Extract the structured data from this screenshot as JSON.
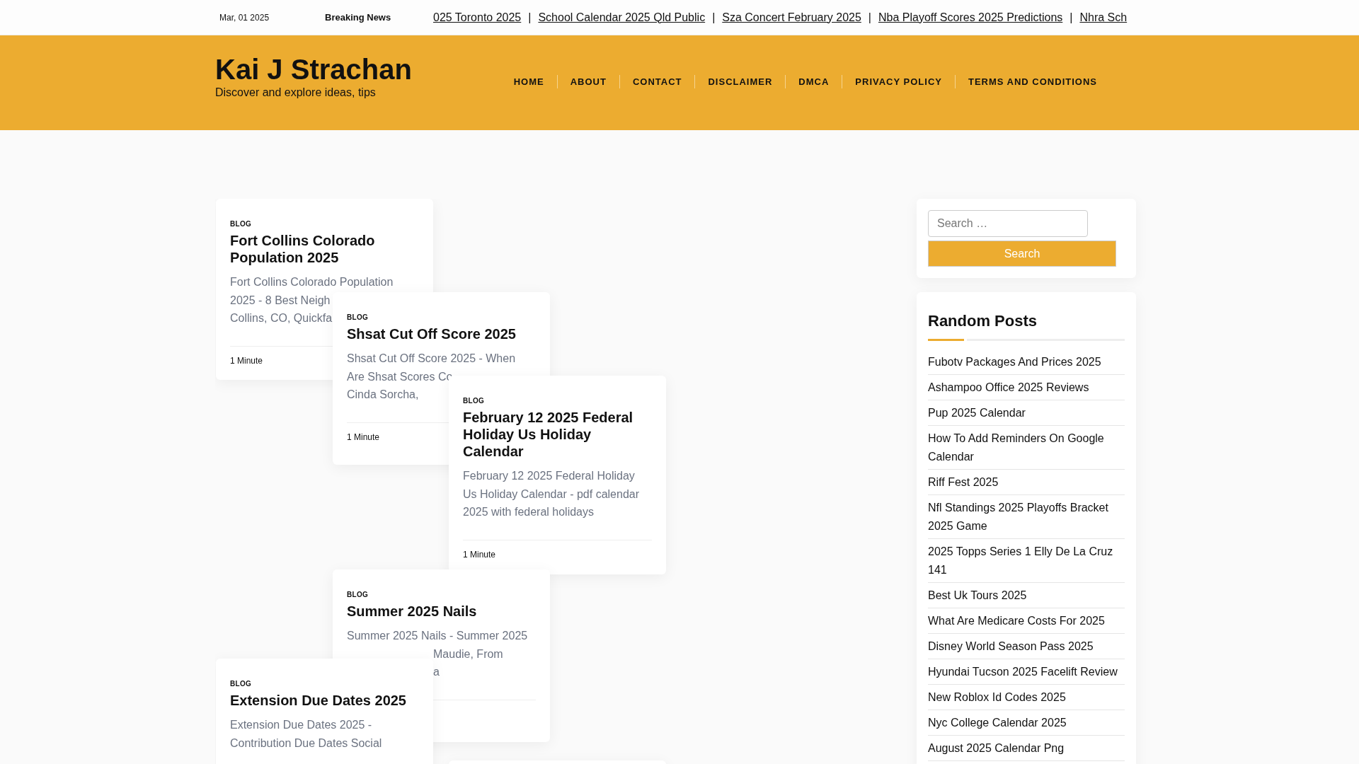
{
  "top_bar": {
    "date": "Mar, 01 2025",
    "breaking_label": "Breaking News",
    "separator": "|",
    "ticker": [
      "025 Toronto 2025",
      "School Calendar 2025 Qld Public",
      "Sza Concert February 2025",
      "Nba Playoff Scores 2025 Predictions",
      "Nhra Sch"
    ]
  },
  "header": {
    "site_title": "Kai J Strachan",
    "tagline": "Discover and explore ideas, tips",
    "nav": [
      "HOME",
      "ABOUT",
      "CONTACT",
      "DISCLAIMER",
      "DMCA",
      "PRIVACY POLICY",
      "TERMS AND CONDITIONS"
    ]
  },
  "cards": [
    {
      "kind": "post",
      "category": "BLOG",
      "title": "Fort Collins Colorado Population 2025",
      "excerpt_lines": [
        "Fort Collins Colorado Population",
        "2025 - 8 Best Neigh",
        "Collins, CO, Quickfa"
      ],
      "read_time": "1 Minute"
    },
    {
      "kind": "post",
      "category": "BLOG",
      "title": "Shsat Cut Off Score 2025",
      "excerpt_lines": [
        "Shsat Cut Off Score 2025 - When",
        "Are Shsat Scores Co",
        "Cinda Sorcha,"
      ],
      "read_time": "1 Minute"
    },
    {
      "kind": "post",
      "category": "BLOG",
      "title": "February 12 2025 Federal Holiday Us Holiday Calendar",
      "excerpt_lines": [
        "February 12 2025 Federal Holiday",
        "Us Holiday Calendar - pdf calendar",
        "2025 with federal holidays"
      ],
      "read_time": "1 Minute"
    },
    {
      "kind": "covered-post",
      "category": "BLOG",
      "title": "Summer 2025 Nails",
      "excerpt_lines": [
        "Summer 2025 Nails - Summer 2025",
        "Maudie, From",
        "a"
      ]
    },
    {
      "kind": "post",
      "category": "BLOG",
      "title": "Extension Due Dates 2025",
      "excerpt_lines": [
        "Extension Due Dates 2025 -",
        "Contribution Due Dates Social"
      ]
    },
    {
      "kind": "edge"
    }
  ],
  "sidebar": {
    "search": {
      "placeholder": "Search …",
      "button": "Search"
    },
    "random_posts": {
      "title": "Random Posts",
      "items": [
        "Fubotv Packages And Prices 2025",
        "Ashampoo Office 2025 Reviews",
        "Pup 2025 Calendar",
        "How To Add Reminders On Google Calendar",
        "Riff Fest 2025",
        "Nfl Standings 2025 Playoffs Bracket 2025 Game",
        "2025 Topps Series 1 Elly De La Cruz 141",
        "Best Uk Tours 2025",
        "What Are Medicare Costs For 2025",
        "Disney World Season Pass 2025",
        "Hyundai Tucson 2025 Facelift Review",
        "New Roblox Id Codes 2025",
        "Nyc College Calendar 2025",
        "August 2025 Calendar Png"
      ]
    }
  }
}
